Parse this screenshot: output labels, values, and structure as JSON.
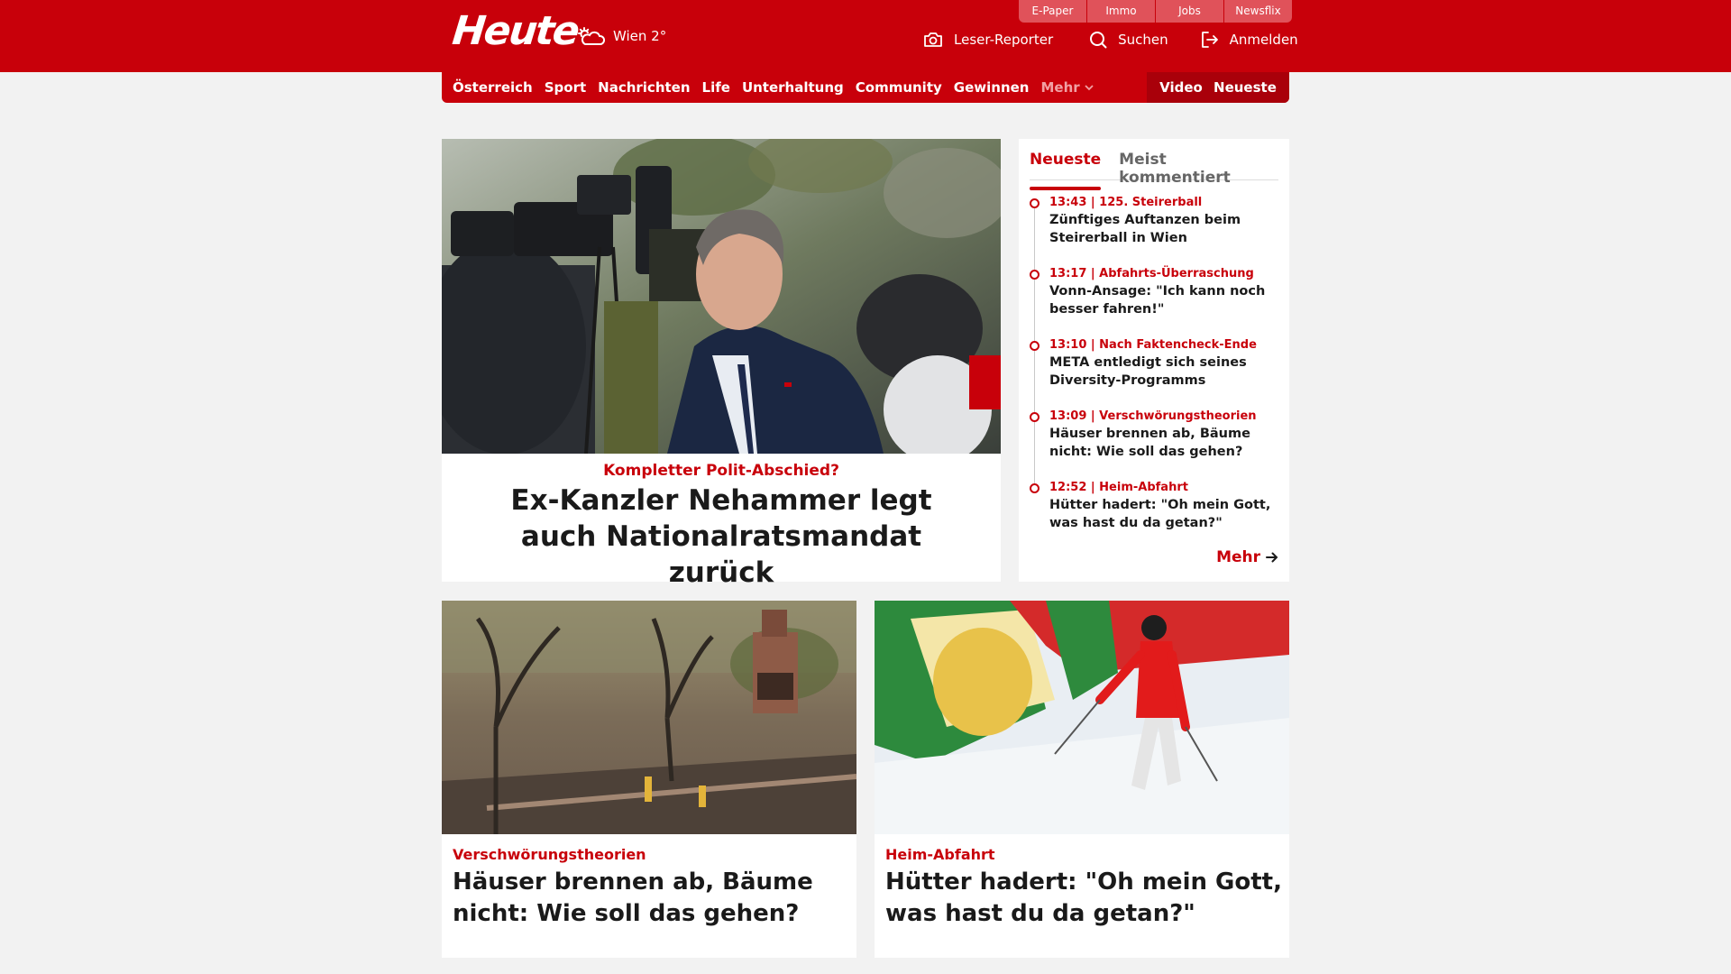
{
  "colors": {
    "brand_red": "#c8000a",
    "dark_red": "#a9000a",
    "light_bg": "#f2f2f2"
  },
  "header": {
    "logo_text": "Heute",
    "weather": {
      "icon": "cloud-sun-icon",
      "text": "Wien 2°"
    },
    "top_links": [
      "E-Paper",
      "Immo",
      "Jobs",
      "Newsflix"
    ],
    "actions": {
      "reporter": {
        "icon": "camera-icon",
        "label": "Leser-Reporter"
      },
      "search": {
        "icon": "search-icon",
        "label": "Suchen"
      },
      "login": {
        "icon": "login-icon",
        "label": "Anmelden"
      }
    }
  },
  "nav": {
    "items": [
      "Österreich",
      "Sport",
      "Nachrichten",
      "Life",
      "Unterhaltung",
      "Community",
      "Gewinnen"
    ],
    "more_label": "Mehr",
    "right_items": [
      "Video",
      "Neueste"
    ]
  },
  "hero": {
    "kicker": "Kompletter Polit-Abschied?",
    "title": "Ex-Kanzler Nehammer legt auch Nationalratsmandat zurück"
  },
  "sidebar": {
    "tabs": [
      "Neueste",
      "Meist kommentiert"
    ],
    "items": [
      {
        "meta": "13:43 | 125. Steirerball",
        "title": "Zünftiges Auftanzen beim Steirerball in Wien"
      },
      {
        "meta": "13:17 | Abfahrts-Überraschung",
        "title": "Vonn-Ansage: \"Ich kann noch besser fahren!\""
      },
      {
        "meta": "13:10 | Nach Faktencheck-Ende",
        "title": "META entledigt sich seines Diversity-Programms"
      },
      {
        "meta": "13:09 | Verschwörungstheorien",
        "title": "Häuser brennen ab, Bäume nicht: Wie soll das gehen?"
      },
      {
        "meta": "12:52 | Heim-Abfahrt",
        "title": "Hütter hadert: \"Oh mein Gott, was hast du da getan?\""
      }
    ],
    "more_label": "Mehr"
  },
  "cards": [
    {
      "kicker": "Verschwörungstheorien",
      "title": "Häuser brennen ab, Bäume nicht: Wie soll das gehen?"
    },
    {
      "kicker": "Heim-Abfahrt",
      "title": "Hütter hadert: \"Oh mein Gott, was hast du da getan?\""
    }
  ]
}
